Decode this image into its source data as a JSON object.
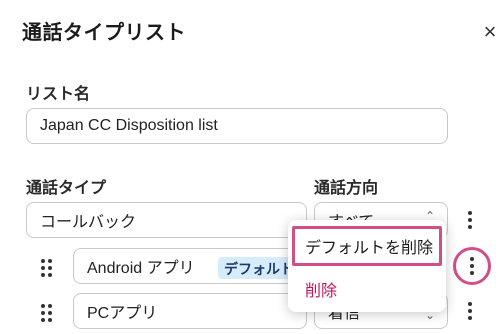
{
  "dialog": {
    "title": "通話タイプリスト",
    "close_glyph": "×"
  },
  "list_name": {
    "label": "リスト名",
    "value": "Japan CC Disposition list"
  },
  "columns": {
    "call_type_label": "通話タイプ",
    "direction_label": "通話方向"
  },
  "rows": [
    {
      "name": "コールバック",
      "direction": "すべて"
    },
    {
      "name": "Android アプリ",
      "badge": "デフォルト",
      "direction": ""
    },
    {
      "name": "PCアプリ",
      "direction": "着信"
    }
  ],
  "context_menu": {
    "items": [
      {
        "label": "デフォルトを削除"
      },
      {
        "label": "削除"
      }
    ]
  },
  "colors": {
    "highlight": "#cf4f86",
    "delete_text": "#c2185b",
    "badge_bg": "#d7ecfb"
  }
}
